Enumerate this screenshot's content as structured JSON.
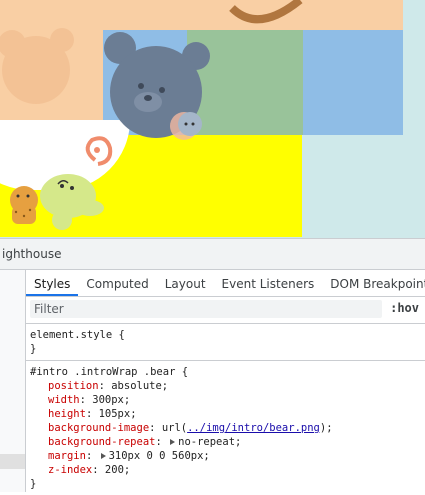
{
  "devtools": {
    "top_panel_label": "ighthouse",
    "tabs": [
      {
        "label": "Styles",
        "active": true
      },
      {
        "label": "Computed",
        "active": false
      },
      {
        "label": "Layout",
        "active": false
      },
      {
        "label": "Event Listeners",
        "active": false
      },
      {
        "label": "DOM Breakpoints",
        "active": false
      }
    ],
    "filter": {
      "placeholder": "Filter",
      "hov_label": ":hov"
    },
    "element_style": {
      "selector": "element.style {",
      "close": "}"
    },
    "rule": {
      "selector": "#intro .introWrap .bear {",
      "declarations": [
        {
          "prop": "position",
          "value": "absolute;"
        },
        {
          "prop": "width",
          "value": "300px;"
        },
        {
          "prop": "height",
          "value": "105px;"
        },
        {
          "prop": "background-image",
          "value_prefix": "url(",
          "link": "../img/intro/bear.png",
          "value_suffix": ");"
        },
        {
          "prop": "background-repeat",
          "value": "no-repeat;"
        },
        {
          "prop": "margin",
          "value": "310px 0 0 560px;"
        },
        {
          "prop": "z-index",
          "value": "200;"
        }
      ],
      "close": "}"
    }
  },
  "colors": {
    "peach": "#f9cfa4",
    "yellow": "#ffff00",
    "overlay_blue": "#8fbde6",
    "overlay_green": "#99c39a",
    "bg_teal": "#cfe9ea",
    "accent_blue": "#1a73e8",
    "css_prop_red": "#c80000"
  }
}
